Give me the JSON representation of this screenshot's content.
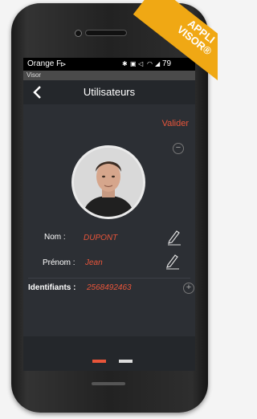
{
  "status_bar": {
    "carrier": "Orange F",
    "battery": "79"
  },
  "app_bar": {
    "app_name": "Visor"
  },
  "header": {
    "title": "Utilisateurs",
    "back_icon": "chevron-left-icon"
  },
  "actions": {
    "validate_label": "Valider",
    "remove_photo_icon": "minus-circle-icon",
    "add_identifier_icon": "plus-circle-icon"
  },
  "user": {
    "nom_label": "Nom :",
    "nom_value": "DUPONT",
    "prenom_label": "Prénom :",
    "prenom_value": "Jean",
    "identifiants_label": "Identifiants :",
    "identifiants_value": "2568492463"
  },
  "banner": {
    "line1": "APPLI",
    "line2": "VISOR®"
  },
  "colors": {
    "accent": "#e8553a",
    "banner": "#f0a814",
    "background": "#2c2f34"
  },
  "pager": {
    "pages": 2,
    "active_index": 0
  }
}
